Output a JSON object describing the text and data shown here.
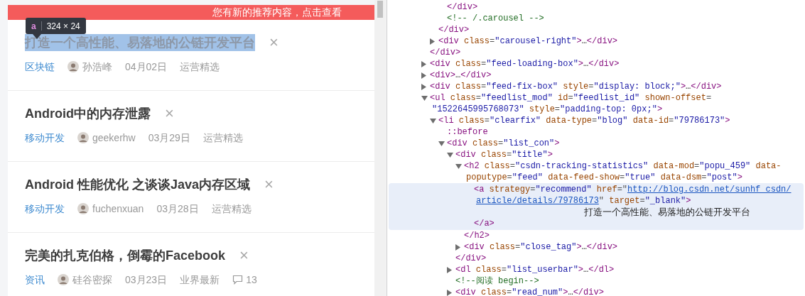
{
  "banner": {
    "text": "您有新的推荐内容，点击查看"
  },
  "inspect_tooltip": {
    "tag": "a",
    "size": "324 × 24"
  },
  "feed": [
    {
      "title": "打造一个高性能、易落地的公链开发平台",
      "inspected": true,
      "close": "×",
      "category": "区块链",
      "author": "孙浩峰",
      "date": "04月02日",
      "tag": "运营精选"
    },
    {
      "title": "Android中的内存泄露",
      "inspected": false,
      "close": "×",
      "category": "移动开发",
      "author": "geekerhw",
      "date": "03月29日",
      "tag": "运营精选"
    },
    {
      "title": "Android 性能优化 之谈谈Java内存区域",
      "inspected": false,
      "close": "×",
      "category": "移动开发",
      "author": "fuchenxuan",
      "date": "03月28日",
      "tag": "运营精选"
    },
    {
      "title": "完美的扎克伯格，倒霉的Facebook",
      "inspected": false,
      "close": "×",
      "category": "资讯",
      "author": "硅谷密探",
      "date": "03月23日",
      "tag": "业界最新",
      "comments": "13"
    }
  ],
  "elements": [
    {
      "selected": false,
      "children": [
        {
          "selected": false,
          "children": [
            {
              "kind": "leaf",
              "selected": false,
              "lines": [
                [
                  {
                    "kind": "tag",
                    "text": "</div>"
                  }
                ]
              ]
            },
            {
              "kind": "leaf",
              "selected": false,
              "lines": [
                [
                  {
                    "kind": "comment",
                    "text": "<!-- /.carousel -->"
                  }
                ]
              ]
            }
          ],
          "close": [
            {
              "kind": "tag",
              "text": "</div>"
            }
          ]
        },
        {
          "kind": "collapsed",
          "selected": false,
          "lines": [
            [
              {
                "kind": "tag",
                "text": "<div"
              },
              {
                "kind": "attr",
                "text": " class"
              },
              {
                "kind": "punct",
                "text": "="
              },
              {
                "kind": "value",
                "text": "\"carousel-right\""
              },
              {
                "kind": "tag",
                "text": ">"
              },
              {
                "kind": "plain",
                "text": "…"
              },
              {
                "kind": "tag",
                "text": "</div>"
              }
            ]
          ]
        }
      ],
      "close": [
        {
          "kind": "tag",
          "text": "</div>"
        }
      ]
    },
    {
      "kind": "collapsed",
      "selected": false,
      "lines": [
        [
          {
            "kind": "tag",
            "text": "<div"
          },
          {
            "kind": "attr",
            "text": " class"
          },
          {
            "kind": "punct",
            "text": "="
          },
          {
            "kind": "value",
            "text": "\"feed-loading-box\""
          },
          {
            "kind": "tag",
            "text": ">"
          },
          {
            "kind": "plain",
            "text": "…"
          },
          {
            "kind": "tag",
            "text": "</div>"
          }
        ]
      ]
    },
    {
      "kind": "collapsed",
      "selected": false,
      "lines": [
        [
          {
            "kind": "tag",
            "text": "<div>"
          },
          {
            "kind": "plain",
            "text": "…"
          },
          {
            "kind": "tag",
            "text": "</div>"
          }
        ]
      ]
    },
    {
      "kind": "collapsed",
      "selected": false,
      "lines": [
        [
          {
            "kind": "tag",
            "text": "<div"
          },
          {
            "kind": "attr",
            "text": " class"
          },
          {
            "kind": "punct",
            "text": "="
          },
          {
            "kind": "value",
            "text": "\"feed-fix-box\""
          },
          {
            "kind": "attr",
            "text": " style"
          },
          {
            "kind": "punct",
            "text": "="
          },
          {
            "kind": "value",
            "text": "\"display: block;\""
          },
          {
            "kind": "tag",
            "text": ">"
          },
          {
            "kind": "plain",
            "text": "…"
          },
          {
            "kind": "tag",
            "text": "</div>"
          }
        ]
      ]
    },
    {
      "kind": "expanded",
      "selected": false,
      "lines": [
        [
          {
            "kind": "tag",
            "text": "<ul"
          },
          {
            "kind": "attr",
            "text": " class"
          },
          {
            "kind": "punct",
            "text": "="
          },
          {
            "kind": "value",
            "text": "\"feedlist_mod\""
          },
          {
            "kind": "attr",
            "text": " id"
          },
          {
            "kind": "punct",
            "text": "="
          },
          {
            "kind": "value",
            "text": "\"feedlist_id\""
          },
          {
            "kind": "attr",
            "text": " shown-offset"
          },
          {
            "kind": "punct",
            "text": "="
          }
        ],
        [
          {
            "kind": "value",
            "text": "\"1522645995768073\""
          },
          {
            "kind": "attr",
            "text": " style"
          },
          {
            "kind": "punct",
            "text": "="
          },
          {
            "kind": "value",
            "text": "\"padding-top: 0px;\""
          },
          {
            "kind": "tag",
            "text": ">"
          }
        ]
      ],
      "children": [
        {
          "kind": "expanded",
          "selected": false,
          "lines": [
            [
              {
                "kind": "tag",
                "text": "<li"
              },
              {
                "kind": "attr",
                "text": " class"
              },
              {
                "kind": "punct",
                "text": "="
              },
              {
                "kind": "value",
                "text": "\"clearfix\""
              },
              {
                "kind": "attr",
                "text": " data-type"
              },
              {
                "kind": "punct",
                "text": "="
              },
              {
                "kind": "value",
                "text": "\"blog\""
              },
              {
                "kind": "attr",
                "text": " data-id"
              },
              {
                "kind": "punct",
                "text": "="
              },
              {
                "kind": "value",
                "text": "\"79786173\""
              },
              {
                "kind": "tag",
                "text": ">"
              }
            ]
          ],
          "children": [
            {
              "kind": "leaf",
              "selected": false,
              "lines": [
                [
                  {
                    "kind": "pseudo",
                    "text": "::before"
                  }
                ]
              ]
            },
            {
              "kind": "expanded",
              "selected": false,
              "lines": [
                [
                  {
                    "kind": "tag",
                    "text": "<div"
                  },
                  {
                    "kind": "attr",
                    "text": " class"
                  },
                  {
                    "kind": "punct",
                    "text": "="
                  },
                  {
                    "kind": "value",
                    "text": "\"list_con\""
                  },
                  {
                    "kind": "tag",
                    "text": ">"
                  }
                ]
              ],
              "children": [
                {
                  "kind": "expanded",
                  "selected": false,
                  "lines": [
                    [
                      {
                        "kind": "tag",
                        "text": "<div"
                      },
                      {
                        "kind": "attr",
                        "text": " class"
                      },
                      {
                        "kind": "punct",
                        "text": "="
                      },
                      {
                        "kind": "value",
                        "text": "\"title\""
                      },
                      {
                        "kind": "tag",
                        "text": ">"
                      }
                    ]
                  ],
                  "children": [
                    {
                      "kind": "expanded",
                      "selected": false,
                      "lines": [
                        [
                          {
                            "kind": "tag",
                            "text": "<h2"
                          },
                          {
                            "kind": "attr",
                            "text": " class"
                          },
                          {
                            "kind": "punct",
                            "text": "="
                          },
                          {
                            "kind": "value",
                            "text": "\"csdn-tracking-statistics\""
                          },
                          {
                            "kind": "attr",
                            "text": " data-mod"
                          },
                          {
                            "kind": "punct",
                            "text": "="
                          },
                          {
                            "kind": "value",
                            "text": "\"popu_459\""
                          },
                          {
                            "kind": "attr",
                            "text": " data-"
                          }
                        ],
                        [
                          {
                            "kind": "attr",
                            "text": "poputype"
                          },
                          {
                            "kind": "punct",
                            "text": "="
                          },
                          {
                            "kind": "value",
                            "text": "\"feed\""
                          },
                          {
                            "kind": "attr",
                            "text": " data-feed-show"
                          },
                          {
                            "kind": "punct",
                            "text": "="
                          },
                          {
                            "kind": "value",
                            "text": "\"true\""
                          },
                          {
                            "kind": "attr",
                            "text": " data-dsm"
                          },
                          {
                            "kind": "punct",
                            "text": "="
                          },
                          {
                            "kind": "value",
                            "text": "\"post\""
                          },
                          {
                            "kind": "tag",
                            "text": ">"
                          }
                        ]
                      ],
                      "children": [
                        {
                          "selected": true,
                          "lines": [
                            [
                              {
                                "kind": "tag",
                                "text": "<a"
                              },
                              {
                                "kind": "attr",
                                "text": " strategy"
                              },
                              {
                                "kind": "punct",
                                "text": "="
                              },
                              {
                                "kind": "value",
                                "text": "\"recommend\""
                              },
                              {
                                "kind": "attr",
                                "text": " href"
                              },
                              {
                                "kind": "punct",
                                "text": "=\""
                              },
                              {
                                "kind": "link",
                                "text": "http://blog.csdn.net/sunhf_csdn/"
                              }
                            ],
                            [
                              {
                                "kind": "link",
                                "text": "article/details/79786173"
                              },
                              {
                                "kind": "punct",
                                "text": "\""
                              },
                              {
                                "kind": "attr",
                                "text": " target"
                              },
                              {
                                "kind": "punct",
                                "text": "="
                              },
                              {
                                "kind": "value",
                                "text": "\"_blank\""
                              },
                              {
                                "kind": "tag",
                                "text": ">"
                              }
                            ]
                          ],
                          "text_content": "打造一个高性能、易落地的公链开发平台",
                          "close": [
                            {
                              "kind": "tag",
                              "text": "</a>"
                            }
                          ]
                        }
                      ],
                      "close": [
                        {
                          "kind": "tag",
                          "text": "</h2>"
                        }
                      ]
                    },
                    {
                      "kind": "collapsed",
                      "selected": false,
                      "lines": [
                        [
                          {
                            "kind": "tag",
                            "text": "<div"
                          },
                          {
                            "kind": "attr",
                            "text": " class"
                          },
                          {
                            "kind": "punct",
                            "text": "="
                          },
                          {
                            "kind": "value",
                            "text": "\"close_tag\""
                          },
                          {
                            "kind": "tag",
                            "text": ">"
                          },
                          {
                            "kind": "plain",
                            "text": "…"
                          },
                          {
                            "kind": "tag",
                            "text": "</div>"
                          }
                        ]
                      ]
                    }
                  ],
                  "close": [
                    {
                      "kind": "tag",
                      "text": "</div>"
                    }
                  ]
                },
                {
                  "kind": "collapsed",
                  "selected": false,
                  "lines": [
                    [
                      {
                        "kind": "tag",
                        "text": "<dl"
                      },
                      {
                        "kind": "attr",
                        "text": " class"
                      },
                      {
                        "kind": "punct",
                        "text": "="
                      },
                      {
                        "kind": "value",
                        "text": "\"list_userbar\""
                      },
                      {
                        "kind": "tag",
                        "text": ">"
                      },
                      {
                        "kind": "plain",
                        "text": "…"
                      },
                      {
                        "kind": "tag",
                        "text": "</dl>"
                      }
                    ]
                  ]
                },
                {
                  "kind": "leaf",
                  "selected": false,
                  "lines": [
                    [
                      {
                        "kind": "comment",
                        "text": "<!--阅读 begin-->"
                      }
                    ]
                  ]
                },
                {
                  "kind": "collapsed",
                  "selected": false,
                  "lines": [
                    [
                      {
                        "kind": "tag",
                        "text": "<div"
                      },
                      {
                        "kind": "attr",
                        "text": " class"
                      },
                      {
                        "kind": "punct",
                        "text": "="
                      },
                      {
                        "kind": "value",
                        "text": "\"read_num\""
                      },
                      {
                        "kind": "tag",
                        "text": ">"
                      },
                      {
                        "kind": "plain",
                        "text": "…"
                      },
                      {
                        "kind": "tag",
                        "text": "</div>"
                      }
                    ]
                  ]
                }
              ]
            }
          ]
        }
      ]
    }
  ]
}
